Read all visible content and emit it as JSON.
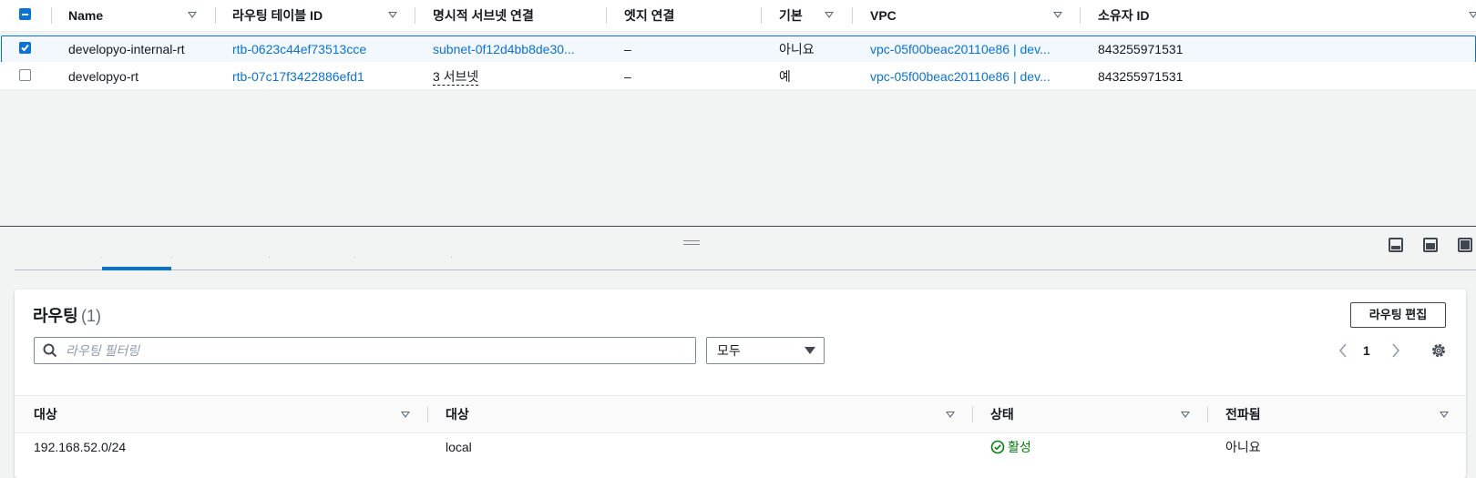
{
  "top_table": {
    "columns": [
      "Name",
      "라우팅 테이블 ID",
      "명시적 서브넷 연결",
      "엣지 연결",
      "기본",
      "VPC",
      "소유자 ID"
    ],
    "rows": [
      {
        "selected": true,
        "name": "developyo-internal-rt",
        "route_table_id": "rtb-0623c44ef73513cce",
        "subnet": "subnet-0f12d4bb8de30...",
        "edge": "–",
        "main": "아니요",
        "vpc": "vpc-05f00beac20110e86 | dev...",
        "owner": "843255971531"
      },
      {
        "selected": false,
        "name": "developyo-rt",
        "route_table_id": "rtb-07c17f3422886efd1",
        "subnet": "3 서브넷",
        "edge": "–",
        "main": "예",
        "vpc": "vpc-05f00beac20110e86 | dev...",
        "owner": "843255971531"
      }
    ]
  },
  "routes_panel": {
    "title": "라우팅",
    "count": "(1)",
    "edit_button": "라우팅 편집",
    "filter_placeholder": "라우팅 필터링",
    "select_value": "모두",
    "page_number": "1",
    "columns": [
      "대상",
      "대상",
      "상태",
      "전파됨"
    ],
    "rows": [
      {
        "destination": "192.168.52.0/24",
        "target": "local",
        "status": "활성",
        "propagated": "아니요"
      }
    ]
  },
  "colors": {
    "accent": "#0972d3",
    "selected_row_bg": "#f2f8fd",
    "success": "#037f0c",
    "border": "#e9ebed",
    "pane_bg": "#f2f3f3"
  },
  "icons": [
    "filter-caret-icon",
    "search-icon",
    "chevron-left-icon",
    "chevron-right-icon",
    "gear-icon",
    "success-check-icon",
    "panel-bottom-icon",
    "panel-half-icon",
    "panel-full-icon",
    "resize-grip-icon"
  ]
}
